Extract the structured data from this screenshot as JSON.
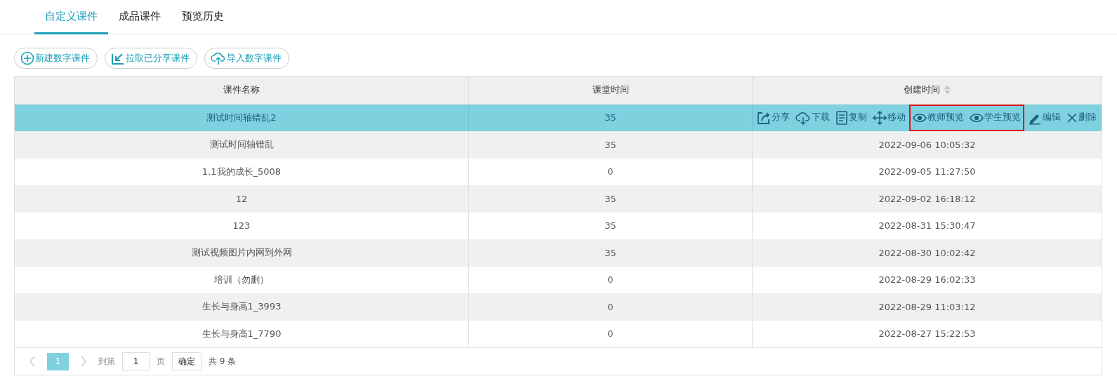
{
  "tabs": [
    {
      "label": "自定义课件",
      "selected": true
    },
    {
      "label": "成品课件",
      "selected": false
    },
    {
      "label": "预览历史",
      "selected": false
    }
  ],
  "toolbar": [
    {
      "label": "新建数字课件",
      "kind": "add"
    },
    {
      "label": "拉取已分享课件",
      "kind": "pull"
    },
    {
      "label": "导入数字课件",
      "kind": "upload"
    }
  ],
  "table": {
    "columns": [
      "课件名称",
      "课堂时间",
      "创建时间"
    ],
    "row_actions": [
      {
        "label": "分享",
        "kind": "share",
        "highlighted": false
      },
      {
        "label": "下载",
        "kind": "download",
        "highlighted": false
      },
      {
        "label": "复制",
        "kind": "copy",
        "highlighted": false
      },
      {
        "label": "移动",
        "kind": "move",
        "highlighted": false
      },
      {
        "label": "教师预览",
        "kind": "preview",
        "highlighted": true
      },
      {
        "label": "学生预览",
        "kind": "preview",
        "highlighted": true
      },
      {
        "label": "编辑",
        "kind": "edit",
        "highlighted": false
      },
      {
        "label": "删除",
        "kind": "delete",
        "highlighted": false
      }
    ],
    "rows": [
      {
        "name": "测试时间轴错乱2",
        "duration": "35",
        "selected": true
      },
      {
        "name": "测试时间轴错乱",
        "duration": "35",
        "created": "2022-09-06 10:05:32",
        "selected": false
      },
      {
        "name": "1.1我的成长_5008",
        "duration": "0",
        "created": "2022-09-05 11:27:50",
        "selected": false
      },
      {
        "name": "12",
        "duration": "35",
        "created": "2022-09-02 16:18:12",
        "selected": false
      },
      {
        "name": "123",
        "duration": "35",
        "created": "2022-08-31 15:30:47",
        "selected": false
      },
      {
        "name": "测试视频图片内网到外网",
        "duration": "35",
        "created": "2022-08-30 10:02:42",
        "selected": false
      },
      {
        "name": "培训（勿删）",
        "duration": "0",
        "created": "2022-08-29 16:02:33",
        "selected": false
      },
      {
        "name": "生长与身高1_3993",
        "duration": "0",
        "created": "2022-08-29 11:03:12",
        "selected": false
      },
      {
        "name": "生长与身高1_7790",
        "duration": "0",
        "created": "2022-08-27 15:22:53",
        "selected": false
      }
    ]
  },
  "pagination": {
    "pages": [
      {
        "label": "1",
        "selected": true
      }
    ],
    "goto_label": "到第",
    "page_input": "1",
    "page_unit": "页",
    "confirm": "确定",
    "total": "共 9 条"
  }
}
